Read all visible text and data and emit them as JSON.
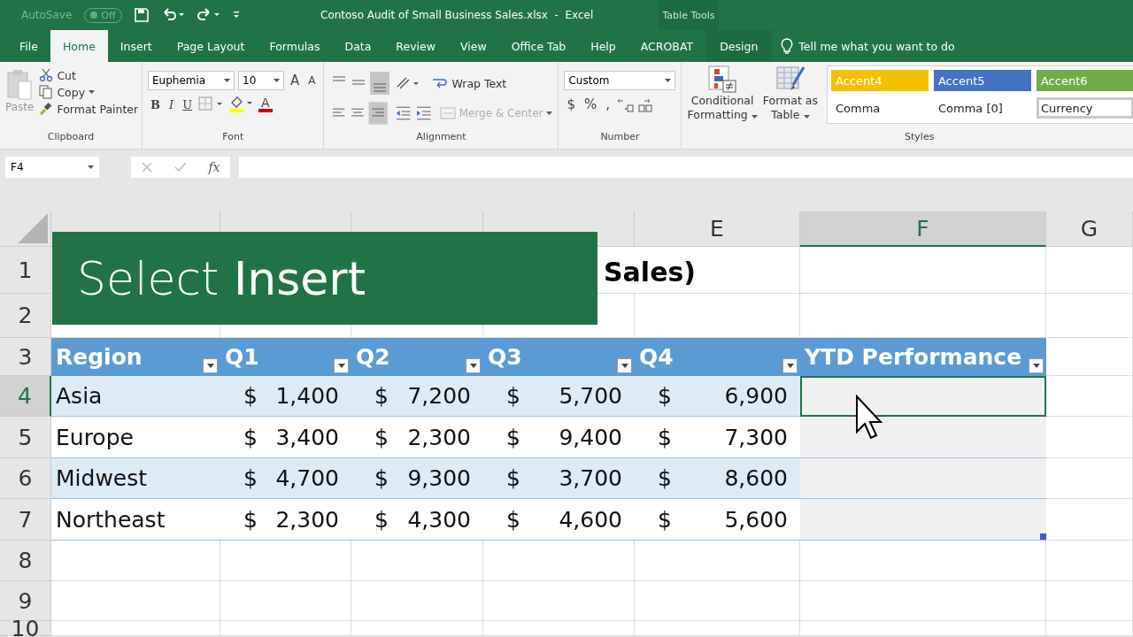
{
  "title_bar": {
    "autosave": {
      "label": "AutoSave",
      "state": "Off",
      "on": false
    },
    "document_title": "Contoso Audit of Small Business Sales.xlsx  -  Excel",
    "context_label": "Table Tools"
  },
  "tabs": [
    {
      "label": "File",
      "selected": false,
      "kind": "normal"
    },
    {
      "label": "Home",
      "selected": true,
      "kind": "normal"
    },
    {
      "label": "Insert",
      "selected": false,
      "kind": "normal"
    },
    {
      "label": "Page Layout",
      "selected": false,
      "kind": "normal"
    },
    {
      "label": "Formulas",
      "selected": false,
      "kind": "normal"
    },
    {
      "label": "Data",
      "selected": false,
      "kind": "normal"
    },
    {
      "label": "Review",
      "selected": false,
      "kind": "normal"
    },
    {
      "label": "View",
      "selected": false,
      "kind": "normal"
    },
    {
      "label": "Office Tab",
      "selected": false,
      "kind": "normal"
    },
    {
      "label": "Help",
      "selected": false,
      "kind": "normal"
    },
    {
      "label": "ACROBAT",
      "selected": false,
      "kind": "normal"
    },
    {
      "label": "Design",
      "selected": false,
      "kind": "contextual"
    }
  ],
  "tell_me": "Tell me what you want to do",
  "ribbon": {
    "clipboard": {
      "paste": "Paste",
      "cut": "Cut",
      "copy": "Copy",
      "format_painter": "Format Painter",
      "label": "Clipboard"
    },
    "font": {
      "font_name": "Euphemia",
      "font_size": "10",
      "grow": "A",
      "shrink": "A",
      "buttons": [
        "B",
        "I",
        "U"
      ],
      "color_letter": "A",
      "label": "Font"
    },
    "alignment": {
      "wrap": "Wrap Text",
      "merge": "Merge & Center",
      "label": "Alignment"
    },
    "number": {
      "format": "Custom",
      "symbols": [
        "$",
        "%",
        ","
      ],
      "label": "Number"
    },
    "styles": {
      "conditional": [
        "Conditional",
        "Formatting"
      ],
      "format_as_table": [
        "Format as",
        "Table"
      ],
      "cells": [
        {
          "label": "Accent4",
          "color": "#f5c000",
          "selected": false
        },
        {
          "label": "Accent5",
          "color": "#4472c4",
          "selected": false
        },
        {
          "label": "Accent6",
          "color": "#70ad47",
          "selected": false
        },
        {
          "label": "Comma",
          "color": "#ffffff",
          "selected": false
        },
        {
          "label": "Comma [0]",
          "color": "#ffffff",
          "selected": false
        },
        {
          "label": "Currency",
          "color": "#ffffff",
          "selected": true
        }
      ],
      "label": "Styles"
    }
  },
  "formula_bar": {
    "name_box": "F4",
    "fx": "fx"
  },
  "sheet": {
    "columns": [
      {
        "selected": false
      },
      {
        "selected": false
      },
      {
        "selected": false
      },
      {
        "selected": false
      },
      {
        "letter": "E",
        "selected": false
      },
      {
        "letter": "F",
        "selected": true
      },
      {
        "letter": "G",
        "selected": false
      }
    ],
    "row_numbers": [
      {
        "number": "1",
        "selected": false
      },
      {
        "number": "2",
        "selected": false
      },
      {
        "number": "3",
        "selected": false
      },
      {
        "number": "4",
        "selected": true
      },
      {
        "number": "5",
        "selected": false
      },
      {
        "number": "6",
        "selected": false
      },
      {
        "number": "7",
        "selected": false
      },
      {
        "number": "8",
        "selected": false
      },
      {
        "number": "9",
        "selected": false
      },
      {
        "number": "10",
        "selected": false
      }
    ],
    "title_fragment": "Sales)",
    "table": {
      "headers": [
        "Region",
        "Q1",
        "Q2",
        "Q3",
        "Q4",
        "YTD Performance"
      ],
      "rows": [
        {
          "region": "Asia",
          "banded": true,
          "values": [
            {
              "currency": "$",
              "amount": "1,400"
            },
            {
              "currency": "$",
              "amount": "7,200"
            },
            {
              "currency": "$",
              "amount": "5,700"
            },
            {
              "currency": "$",
              "amount": "6,900"
            }
          ]
        },
        {
          "region": "Europe",
          "banded": false,
          "values": [
            {
              "currency": "$",
              "amount": "3,400"
            },
            {
              "currency": "$",
              "amount": "2,300"
            },
            {
              "currency": "$",
              "amount": "9,400"
            },
            {
              "currency": "$",
              "amount": "7,300"
            }
          ]
        },
        {
          "region": "Midwest",
          "banded": true,
          "values": [
            {
              "currency": "$",
              "amount": "4,700"
            },
            {
              "currency": "$",
              "amount": "9,300"
            },
            {
              "currency": "$",
              "amount": "3,700"
            },
            {
              "currency": "$",
              "amount": "8,600"
            }
          ]
        },
        {
          "region": "Northeast",
          "banded": false,
          "values": [
            {
              "currency": "$",
              "amount": "2,300"
            },
            {
              "currency": "$",
              "amount": "4,300"
            },
            {
              "currency": "$",
              "amount": "4,600"
            },
            {
              "currency": "$",
              "amount": "5,600"
            }
          ]
        }
      ]
    }
  },
  "overlay": {
    "text": "Select **Insert**"
  }
}
